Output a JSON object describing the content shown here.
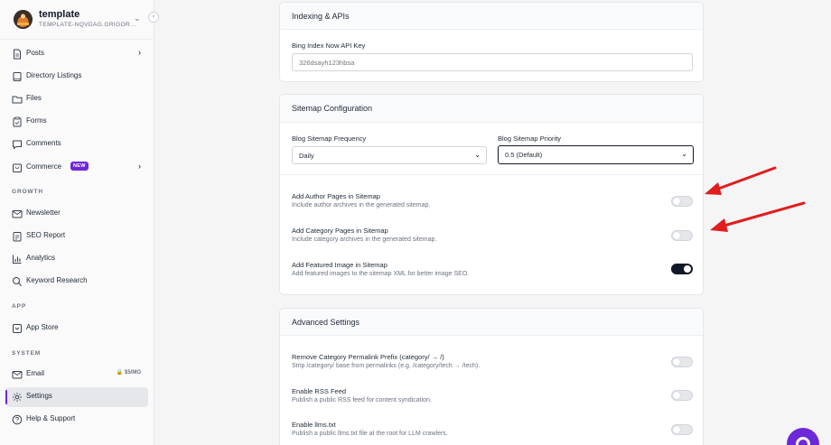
{
  "workspace": {
    "name": "template",
    "subtitle": "TEMPLATE-NQVDAG.GRIGOR..."
  },
  "sidebar": {
    "items": [
      {
        "label": "Posts",
        "icon": "document-icon",
        "chevron": "›"
      },
      {
        "label": "Directory Listings",
        "icon": "book-icon"
      },
      {
        "label": "Files",
        "icon": "folder-icon"
      },
      {
        "label": "Forms",
        "icon": "clipboard-icon"
      },
      {
        "label": "Comments",
        "icon": "chat-icon"
      },
      {
        "label": "Commerce",
        "icon": "cart-icon",
        "badge": "NEW",
        "chevron": "›"
      }
    ],
    "growth_label": "GROWTH",
    "growth": [
      {
        "label": "Newsletter",
        "icon": "mail-icon"
      },
      {
        "label": "SEO Report",
        "icon": "report-icon"
      },
      {
        "label": "Analytics",
        "icon": "chart-icon"
      },
      {
        "label": "Keyword Research",
        "icon": "search-icon"
      }
    ],
    "app_label": "APP",
    "app": [
      {
        "label": "App Store",
        "icon": "store-icon"
      }
    ],
    "system_label": "SYSTEM",
    "system": [
      {
        "label": "Email",
        "icon": "mail-icon",
        "price": "🔒 $5/MO"
      },
      {
        "label": "Settings",
        "icon": "gear-icon",
        "active": true
      },
      {
        "label": "Help & Support",
        "icon": "help-icon"
      }
    ]
  },
  "indexing": {
    "title": "Indexing & APIs",
    "bing_label": "Bing Index Now API Key",
    "bing_placeholder": "326dsayh123hbsa"
  },
  "sitemap": {
    "title": "Sitemap Configuration",
    "frequency_label": "Blog Sitemap Frequency",
    "frequency_value": "Daily",
    "priority_label": "Blog Sitemap Priority",
    "priority_value": "0.5 (Default)",
    "toggles": [
      {
        "title": "Add Author Pages in Sitemap",
        "desc": "Include author archives in the generated sitemap.",
        "on": false
      },
      {
        "title": "Add Category Pages in Sitemap",
        "desc": "Include category archives in the generated sitemap.",
        "on": false
      },
      {
        "title": "Add Featured Image in Sitemap",
        "desc": "Add featured images to the sitemap XML for better image SEO.",
        "on": true
      }
    ]
  },
  "advanced": {
    "title": "Advanced Settings",
    "toggles": [
      {
        "title": "Remove Category Permalink Prefix (category/ → /)",
        "desc": "Strip /category/ base from permalinks (e.g. /category/tech → /tech).",
        "on": false
      },
      {
        "title": "Enable RSS Feed",
        "desc": "Publish a public RSS feed for content syndication.",
        "on": false
      },
      {
        "title": "Enable llms.txt",
        "desc": "Publish a public llms.txt file at the root for LLM crawlers.",
        "on": false
      }
    ]
  },
  "colors": {
    "accent": "#6d28d9",
    "arrow": "#e11d1d",
    "toggle_on": "#111827"
  }
}
